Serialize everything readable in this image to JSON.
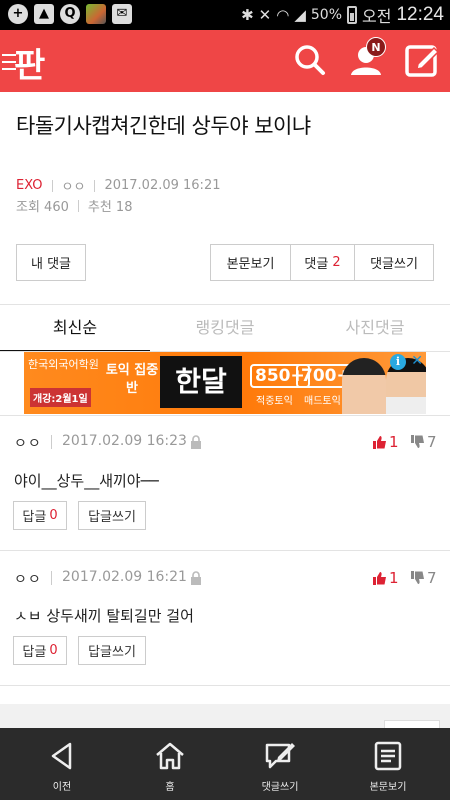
{
  "statusbar": {
    "battery": "50%",
    "ampm": "오전",
    "time": "12:24",
    "left_icons": [
      "add-icon",
      "image-icon",
      "search-icon",
      "thumbnail-icon",
      "mail-icon"
    ],
    "right_icons": [
      "bluetooth-icon",
      "mute-icon",
      "wifi-icon",
      "signal-icon",
      "battery-icon"
    ]
  },
  "header": {
    "logo": "판",
    "badge": "N",
    "icons": [
      "menu-icon",
      "search-icon",
      "user-icon",
      "write-icon"
    ],
    "color": "#ef4646"
  },
  "post": {
    "title": "타돌기사캡쳐긴한데 상두야 보이냐",
    "category": "EXO",
    "author": "ㅇㅇ",
    "date": "2017.02.09 16:21",
    "views": "조회 460",
    "recommends": "추천 18"
  },
  "actions": {
    "my_comments": "내 댓글",
    "view_post": "본문보기",
    "comments_label": "댓글",
    "comments_count": "2",
    "write_comment": "댓글쓰기"
  },
  "tabs": [
    "최신순",
    "랭킹댓글",
    "사진댓글"
  ],
  "ad": {
    "school": "한국외국어학원",
    "open": "개강:2월1일",
    "toeic": "토익 집중반",
    "main": "한달",
    "score1": "850+",
    "score2": "700+",
    "sub1": "적중토익",
    "sub2": "매드토익"
  },
  "comments": [
    {
      "author": "ㅇㅇ",
      "date": "2017.02.09 16:23",
      "likes": "1",
      "dislikes": "7",
      "body": "야이__상두__새끼야──",
      "reply_label": "답글",
      "reply_count": "0",
      "write_reply": "답글쓰기"
    },
    {
      "author": "ㅇㅇ",
      "date": "2017.02.09 16:21",
      "likes": "1",
      "dislikes": "7",
      "body": "ㅅㅂ 상두새끼 탈퇴길만 걸어",
      "reply_label": "답글",
      "reply_count": "0",
      "write_reply": "답글쓰기"
    }
  ],
  "bottom_nav": [
    {
      "label": "이전",
      "icon": "back-icon"
    },
    {
      "label": "홈",
      "icon": "home-icon"
    },
    {
      "label": "댓글쓰기",
      "icon": "comment-write-icon"
    },
    {
      "label": "본문보기",
      "icon": "document-icon"
    }
  ]
}
